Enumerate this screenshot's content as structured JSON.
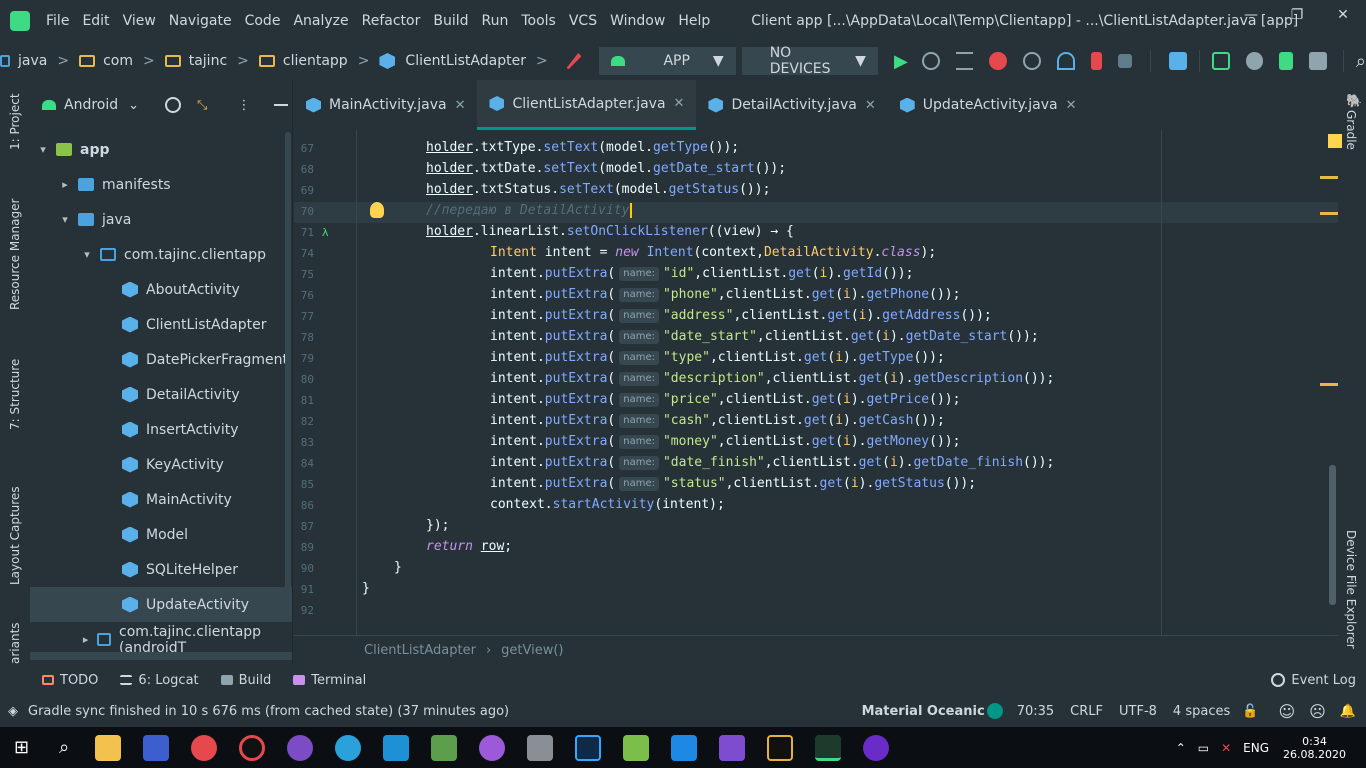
{
  "titlebar": {
    "menu": [
      "File",
      "Edit",
      "View",
      "Navigate",
      "Code",
      "Analyze",
      "Refactor",
      "Build",
      "Run",
      "Tools",
      "VCS",
      "Window",
      "Help"
    ],
    "title": "Client app [...\\AppData\\Local\\Temp\\Clientapp] - ...\\ClientListAdapter.java [app]",
    "min": "—",
    "max": "❐",
    "close": "✕"
  },
  "navbar": {
    "crumbs": [
      "java",
      "com",
      "tajinc",
      "clientapp",
      "ClientListAdapter"
    ],
    "run_config": "APP",
    "device": "NO DEVICES"
  },
  "left_strip": {
    "project": "1: Project",
    "resource": "Resource Manager",
    "structure": "7: Structure",
    "layout": "Layout Captures",
    "variants": "ariants"
  },
  "project": {
    "view": "Android",
    "items": [
      {
        "label": "app",
        "indent": 0,
        "arrow": "▾",
        "icon": "module"
      },
      {
        "label": "manifests",
        "indent": 1,
        "arrow": "▸",
        "icon": "folder"
      },
      {
        "label": "java",
        "indent": 1,
        "arrow": "▾",
        "icon": "folder"
      },
      {
        "label": "com.tajinc.clientapp",
        "indent": 2,
        "arrow": "▾",
        "icon": "package"
      },
      {
        "label": "AboutActivity",
        "indent": 3,
        "arrow": "",
        "icon": "class"
      },
      {
        "label": "ClientListAdapter",
        "indent": 3,
        "arrow": "",
        "icon": "class"
      },
      {
        "label": "DatePickerFragment",
        "indent": 3,
        "arrow": "",
        "icon": "class"
      },
      {
        "label": "DetailActivity",
        "indent": 3,
        "arrow": "",
        "icon": "class"
      },
      {
        "label": "InsertActivity",
        "indent": 3,
        "arrow": "",
        "icon": "class"
      },
      {
        "label": "KeyActivity",
        "indent": 3,
        "arrow": "",
        "icon": "class"
      },
      {
        "label": "MainActivity",
        "indent": 3,
        "arrow": "",
        "icon": "class"
      },
      {
        "label": "Model",
        "indent": 3,
        "arrow": "",
        "icon": "class"
      },
      {
        "label": "SQLiteHelper",
        "indent": 3,
        "arrow": "",
        "icon": "class"
      },
      {
        "label": "UpdateActivity",
        "indent": 3,
        "arrow": "",
        "icon": "class",
        "selected": true
      },
      {
        "label": "com.tajinc.clientapp (androidT",
        "indent": 2,
        "arrow": "▸",
        "icon": "package"
      }
    ]
  },
  "tabs": [
    {
      "label": "MainActivity.java",
      "active": false
    },
    {
      "label": "ClientListAdapter.java",
      "active": true
    },
    {
      "label": "DetailActivity.java",
      "active": false
    },
    {
      "label": "UpdateActivity.java",
      "active": false
    }
  ],
  "editor": {
    "line_numbers": [
      "67",
      "68",
      "69",
      "70",
      "71",
      "74",
      "75",
      "76",
      "77",
      "78",
      "79",
      "80",
      "81",
      "82",
      "83",
      "84",
      "85",
      "86",
      "87",
      "89",
      "90",
      "91",
      "92"
    ],
    "hint": "name:",
    "lines": {
      "l67": {
        "obj": "holder",
        "rest1": ".txtType.",
        "m1": "setText",
        "rest2": "(model.",
        "m2": "getType",
        "rest3": "());"
      },
      "l68": {
        "obj": "holder",
        "rest1": ".txtDate.",
        "m1": "setText",
        "rest2": "(model.",
        "m2": "getDate_start",
        "rest3": "());"
      },
      "l69": {
        "obj": "holder",
        "rest1": ".txtStatus.",
        "m1": "setText",
        "rest2": "(model.",
        "m2": "getStatus",
        "rest3": "());"
      },
      "l70": {
        "comment": "//передаю в DetailActivity"
      },
      "l71": {
        "obj": "holder",
        "rest1": ".linearList.",
        "m1": "setOnClickListener",
        "rest2": "((view) → {"
      },
      "l74": {
        "t1": "Intent",
        "t2": " intent = ",
        "kw": "new",
        "t3": "Intent",
        "t4": "(context,",
        "t5": "DetailActivity",
        "t6": ".",
        "kw2": "class",
        "t7": ");"
      },
      "l86": {
        "t1": "context.",
        "m1": "startActivity",
        "t2": "(intent);"
      },
      "l87": {
        "t1": "});"
      },
      "l89": {
        "kw": "return",
        "t1": " ",
        "obj": "row",
        "t2": ";"
      },
      "l90": {
        "t1": "}"
      },
      "l91": {
        "t1": "}"
      }
    },
    "extras": [
      {
        "key": "\"id\"",
        "getter": "getId"
      },
      {
        "key": "\"phone\"",
        "getter": "getPhone"
      },
      {
        "key": "\"address\"",
        "getter": "getAddress"
      },
      {
        "key": "\"date_start\"",
        "getter": "getDate_start"
      },
      {
        "key": "\"type\"",
        "getter": "getType"
      },
      {
        "key": "\"description\"",
        "getter": "getDescription"
      },
      {
        "key": "\"price\"",
        "getter": "getPrice"
      },
      {
        "key": "\"cash\"",
        "getter": "getCash"
      },
      {
        "key": "\"money\"",
        "getter": "getMoney"
      },
      {
        "key": "\"date_finish\"",
        "getter": "getDate_finish"
      },
      {
        "key": "\"status\"",
        "getter": "getStatus"
      }
    ],
    "breadcrumb": [
      "ClientListAdapter",
      "getView()"
    ]
  },
  "right_strip": {
    "gradle": "Gradle",
    "device_explorer": "Device File Explorer"
  },
  "bottom_tools": [
    "TODO",
    "6: Logcat",
    "Build",
    "Terminal"
  ],
  "event_log": "Event Log",
  "status": {
    "message": "Gradle sync finished in 10 s 676 ms (from cached state) (37 minutes ago)",
    "theme": "Material Oceanic",
    "position": "70:35",
    "line_sep": "CRLF",
    "encoding": "UTF-8",
    "indent": "4 spaces"
  },
  "taskbar": {
    "lang": "ENG",
    "time": "0:34",
    "date": "26.08.2020"
  },
  "colors": {
    "accent": "#009688",
    "bg": "#263238",
    "keyword": "#c792ea",
    "string": "#c3e88d",
    "method": "#82aaff",
    "class": "#ffcb6b"
  }
}
